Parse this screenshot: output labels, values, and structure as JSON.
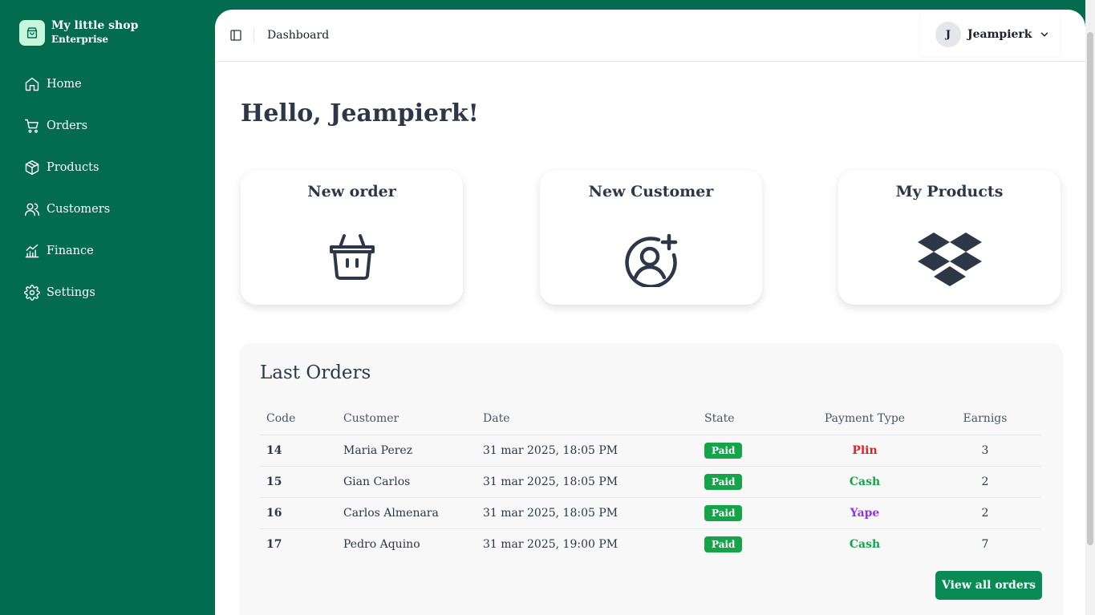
{
  "brand": {
    "name": "My little shop",
    "subtitle": "Enterprise"
  },
  "nav": [
    {
      "label": "Home",
      "icon": "home-icon"
    },
    {
      "label": "Orders",
      "icon": "cart-icon"
    },
    {
      "label": "Products",
      "icon": "package-icon"
    },
    {
      "label": "Customers",
      "icon": "users-icon"
    },
    {
      "label": "Finance",
      "icon": "chart-icon"
    },
    {
      "label": "Settings",
      "icon": "gear-icon"
    }
  ],
  "header": {
    "breadcrumb": "Dashboard",
    "user_initial": "J",
    "user_name": "Jeampierk"
  },
  "greeting": "Hello, Jeampierk!",
  "cards": [
    {
      "title": "New order",
      "icon": "basket-icon"
    },
    {
      "title": "New Customer",
      "icon": "user-plus-icon"
    },
    {
      "title": "My Products",
      "icon": "dropbox-icon"
    }
  ],
  "orders": {
    "title": "Last Orders",
    "columns": [
      "Code",
      "Customer",
      "Date",
      "State",
      "Payment Type",
      "Earnigs"
    ],
    "rows": [
      {
        "code": "14",
        "customer": "Maria Perez",
        "date": "31 mar 2025, 18:05 PM",
        "state": "Paid",
        "payment": "Plin",
        "earnings": "3"
      },
      {
        "code": "15",
        "customer": "Gian Carlos",
        "date": "31 mar 2025, 18:05 PM",
        "state": "Paid",
        "payment": "Cash",
        "earnings": "2"
      },
      {
        "code": "16",
        "customer": "Carlos Almenara",
        "date": "31 mar 2025, 18:05 PM",
        "state": "Paid",
        "payment": "Yape",
        "earnings": "2"
      },
      {
        "code": "17",
        "customer": "Pedro Aquino",
        "date": "31 mar 2025, 19:00 PM",
        "state": "Paid",
        "payment": "Cash",
        "earnings": "7"
      }
    ],
    "view_all_label": "View all orders"
  },
  "colors": {
    "sidebar": "#036b4e",
    "paid_badge": "#16a34a",
    "plin": "#dc2626",
    "cash": "#16a34a",
    "yape": "#9333ea"
  }
}
